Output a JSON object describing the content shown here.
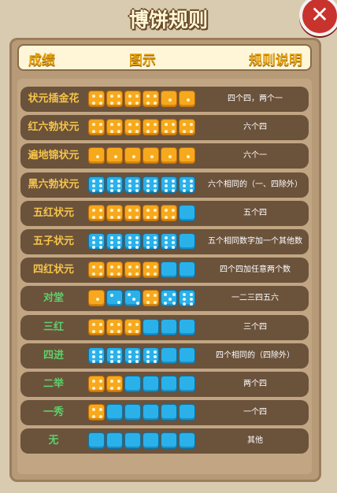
{
  "title": "博饼规则",
  "close_label": "✕",
  "header": {
    "col1": "成绩",
    "col2": "图示",
    "col3": "规则说明"
  },
  "colors": {
    "orange_die": "#f7a91e",
    "blue_die": "#2ab1ea",
    "row_bg": "#6b523b",
    "gold_text": "#f5c54a",
    "green_text": "#5cd16b"
  },
  "rules": [
    {
      "name": "状元插金花",
      "color": "gold",
      "dice": [
        [
          "o",
          4
        ],
        [
          "o",
          4
        ],
        [
          "o",
          4
        ],
        [
          "o",
          4
        ],
        [
          "o",
          1
        ],
        [
          "o",
          1
        ]
      ],
      "desc": "四个四，两个一"
    },
    {
      "name": "红六勃状元",
      "color": "gold",
      "dice": [
        [
          "o",
          4
        ],
        [
          "o",
          4
        ],
        [
          "o",
          4
        ],
        [
          "o",
          4
        ],
        [
          "o",
          4
        ],
        [
          "o",
          4
        ]
      ],
      "desc": "六个四"
    },
    {
      "name": "遍地锦状元",
      "color": "gold",
      "dice": [
        [
          "o",
          1
        ],
        [
          "o",
          1
        ],
        [
          "o",
          1
        ],
        [
          "o",
          1
        ],
        [
          "o",
          1
        ],
        [
          "o",
          1
        ]
      ],
      "desc": "六个一"
    },
    {
      "name": "黑六勃状元",
      "color": "gold",
      "dice": [
        [
          "b",
          6
        ],
        [
          "b",
          6
        ],
        [
          "b",
          6
        ],
        [
          "b",
          6
        ],
        [
          "b",
          6
        ],
        [
          "b",
          6
        ]
      ],
      "desc": "六个相同的（一、四除外）"
    },
    {
      "name": "五红状元",
      "color": "gold",
      "dice": [
        [
          "o",
          4
        ],
        [
          "o",
          4
        ],
        [
          "o",
          4
        ],
        [
          "o",
          4
        ],
        [
          "o",
          4
        ],
        [
          "b",
          0
        ]
      ],
      "desc": "五个四"
    },
    {
      "name": "五子状元",
      "color": "gold",
      "dice": [
        [
          "b",
          6
        ],
        [
          "b",
          6
        ],
        [
          "b",
          6
        ],
        [
          "b",
          6
        ],
        [
          "b",
          6
        ],
        [
          "b",
          0
        ]
      ],
      "desc": "五个相同数字加一个其他数"
    },
    {
      "name": "四红状元",
      "color": "gold",
      "dice": [
        [
          "o",
          4
        ],
        [
          "o",
          4
        ],
        [
          "o",
          4
        ],
        [
          "o",
          4
        ],
        [
          "b",
          0
        ],
        [
          "b",
          0
        ]
      ],
      "desc": "四个四加任意两个数"
    },
    {
      "name": "对堂",
      "color": "green",
      "dice": [
        [
          "o",
          1
        ],
        [
          "b",
          2
        ],
        [
          "b",
          3
        ],
        [
          "o",
          4
        ],
        [
          "b",
          5
        ],
        [
          "b",
          6
        ]
      ],
      "desc": "一二三四五六"
    },
    {
      "name": "三红",
      "color": "green",
      "dice": [
        [
          "o",
          4
        ],
        [
          "o",
          4
        ],
        [
          "o",
          4
        ],
        [
          "b",
          0
        ],
        [
          "b",
          0
        ],
        [
          "b",
          0
        ]
      ],
      "desc": "三个四"
    },
    {
      "name": "四进",
      "color": "green",
      "dice": [
        [
          "b",
          6
        ],
        [
          "b",
          6
        ],
        [
          "b",
          6
        ],
        [
          "b",
          6
        ],
        [
          "b",
          0
        ],
        [
          "b",
          0
        ]
      ],
      "desc": "四个相同的（四除外）"
    },
    {
      "name": "二举",
      "color": "green",
      "dice": [
        [
          "o",
          4
        ],
        [
          "o",
          4
        ],
        [
          "b",
          0
        ],
        [
          "b",
          0
        ],
        [
          "b",
          0
        ],
        [
          "b",
          0
        ]
      ],
      "desc": "两个四"
    },
    {
      "name": "一秀",
      "color": "green",
      "dice": [
        [
          "o",
          4
        ],
        [
          "b",
          0
        ],
        [
          "b",
          0
        ],
        [
          "b",
          0
        ],
        [
          "b",
          0
        ],
        [
          "b",
          0
        ]
      ],
      "desc": "一个四"
    },
    {
      "name": "无",
      "color": "green",
      "dice": [
        [
          "b",
          0
        ],
        [
          "b",
          0
        ],
        [
          "b",
          0
        ],
        [
          "b",
          0
        ],
        [
          "b",
          0
        ],
        [
          "b",
          0
        ]
      ],
      "desc": "其他"
    }
  ]
}
